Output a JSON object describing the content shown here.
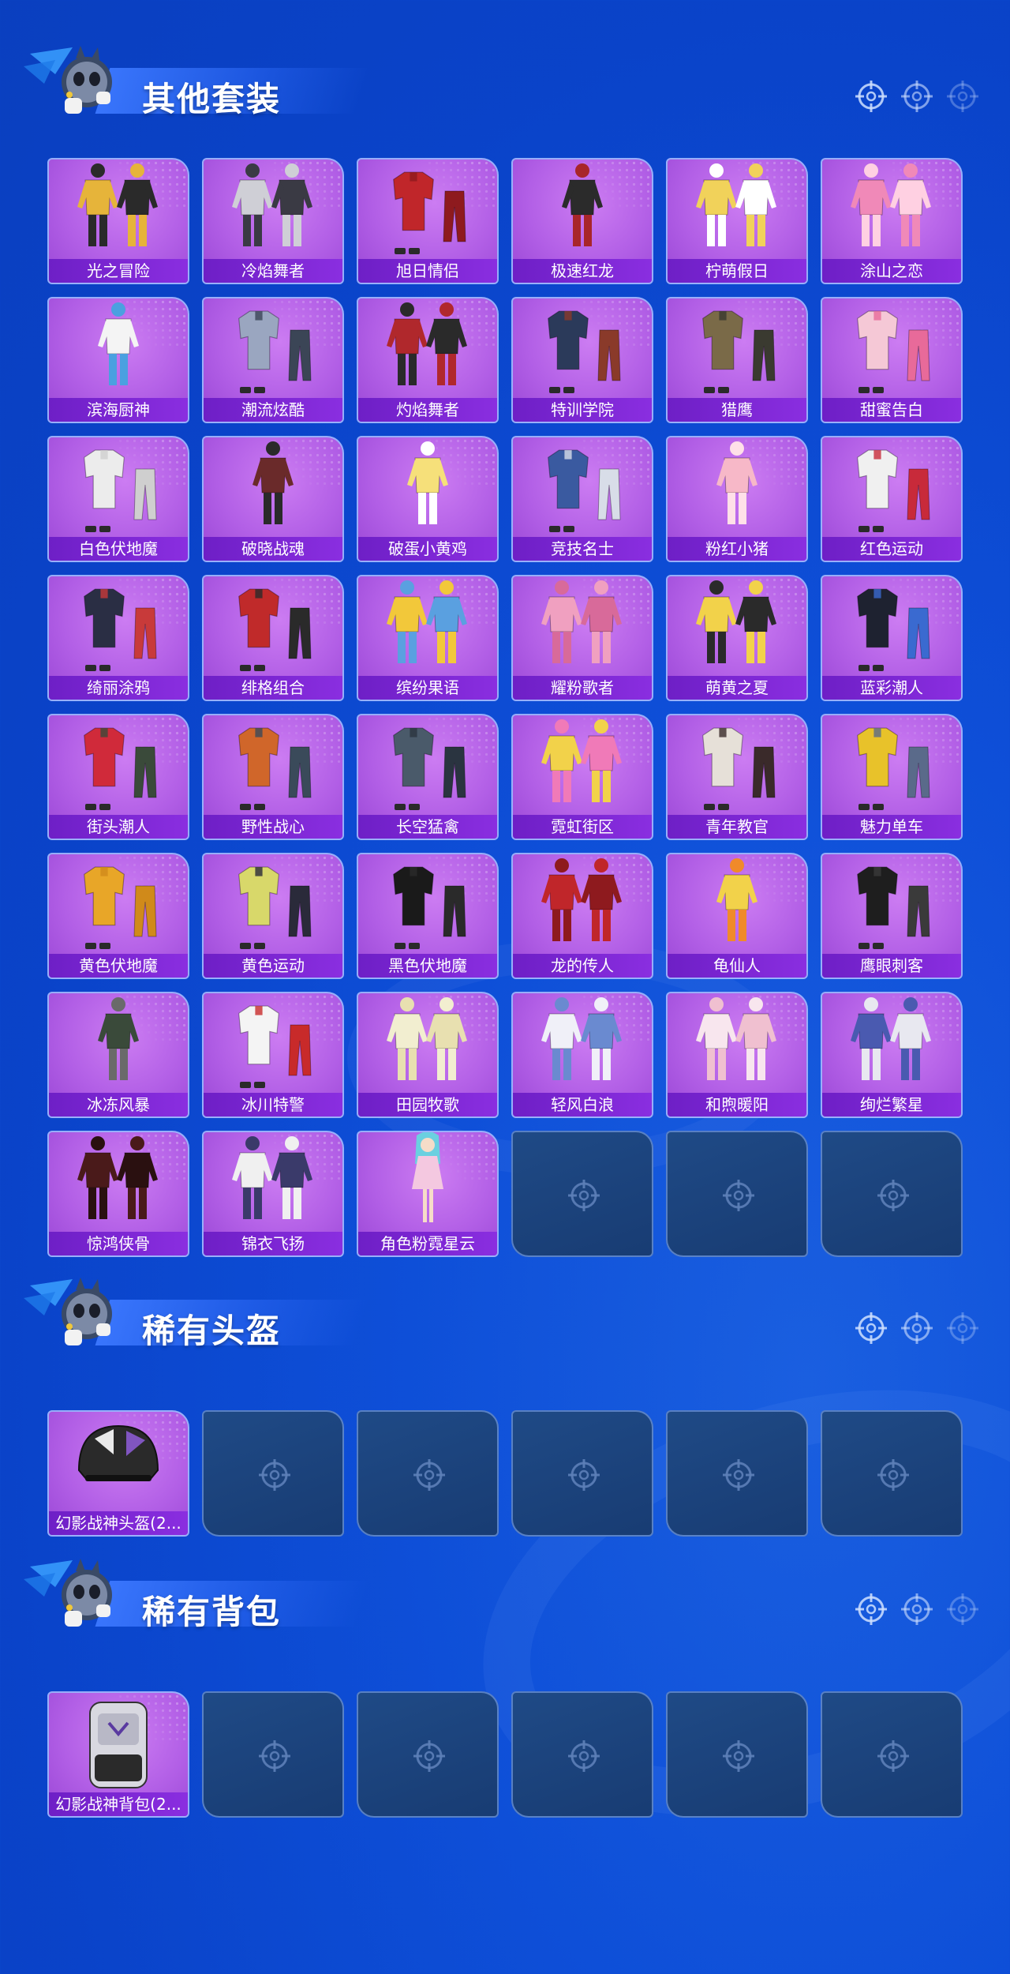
{
  "sections": [
    {
      "id": "sets",
      "title": "其他套装",
      "items": [
        {
          "label": "光之冒险",
          "kind": "duo",
          "c1": "#e6b43a",
          "c2": "#2a2a2a"
        },
        {
          "label": "冷焰舞者",
          "kind": "duo",
          "c1": "#cfcfd6",
          "c2": "#3a3a44"
        },
        {
          "label": "旭日情侣",
          "kind": "outfit",
          "c1": "#c0262a",
          "c2": "#8e1a1e"
        },
        {
          "label": "极速红龙",
          "kind": "figure",
          "c1": "#2b2b2b",
          "c2": "#a8262a"
        },
        {
          "label": "柠萌假日",
          "kind": "duo",
          "c1": "#f1d25a",
          "c2": "#ffffff"
        },
        {
          "label": "涂山之恋",
          "kind": "duo",
          "c1": "#f089b8",
          "c2": "#ffd0e2"
        },
        {
          "label": "滨海厨神",
          "kind": "figure",
          "c1": "#f4f4f4",
          "c2": "#4aa0e0"
        },
        {
          "label": "潮流炫酷",
          "kind": "outfit",
          "c1": "#9aa6c0",
          "c2": "#3b4556"
        },
        {
          "label": "灼焰舞者",
          "kind": "duo",
          "c1": "#b0282c",
          "c2": "#2a2a2a"
        },
        {
          "label": "特训学院",
          "kind": "outfit",
          "c1": "#2b3a5a",
          "c2": "#8a3a2a"
        },
        {
          "label": "猎鹰",
          "kind": "outfit",
          "c1": "#7a6a48",
          "c2": "#3a3a30"
        },
        {
          "label": "甜蜜告白",
          "kind": "outfit",
          "c1": "#f5c8d6",
          "c2": "#e86a9a"
        },
        {
          "label": "白色伏地魔",
          "kind": "outfit",
          "c1": "#ececec",
          "c2": "#cfcfcf"
        },
        {
          "label": "破晓战魂",
          "kind": "figure",
          "c1": "#6a2a2a",
          "c2": "#2a2a2a"
        },
        {
          "label": "破蛋小黄鸡",
          "kind": "figure",
          "c1": "#f6e07a",
          "c2": "#ffffff"
        },
        {
          "label": "竞技名士",
          "kind": "outfit",
          "c1": "#3a5aa0",
          "c2": "#d8dde8"
        },
        {
          "label": "粉红小猪",
          "kind": "figure",
          "c1": "#f7b8c8",
          "c2": "#ffe0e8"
        },
        {
          "label": "红色运动",
          "kind": "outfit",
          "c1": "#f0f0f0",
          "c2": "#c82a3a"
        },
        {
          "label": "绮丽涂鸦",
          "kind": "outfit",
          "c1": "#2a2e44",
          "c2": "#c83a3a"
        },
        {
          "label": "绯格组合",
          "kind": "outfit",
          "c1": "#c02a2a",
          "c2": "#2a2a2a"
        },
        {
          "label": "缤纷果语",
          "kind": "duo",
          "c1": "#f2c83a",
          "c2": "#5aa0e0"
        },
        {
          "label": "耀粉歌者",
          "kind": "duo",
          "c1": "#f0a0c0",
          "c2": "#d86a9a"
        },
        {
          "label": "萌黄之夏",
          "kind": "duo",
          "c1": "#f2d24a",
          "c2": "#2a2a2a"
        },
        {
          "label": "蓝彩潮人",
          "kind": "outfit",
          "c1": "#1e2230",
          "c2": "#3a6ad0"
        },
        {
          "label": "街头潮人",
          "kind": "outfit",
          "c1": "#d02a3a",
          "c2": "#3a4a3a"
        },
        {
          "label": "野性战心",
          "kind": "outfit",
          "c1": "#d0662a",
          "c2": "#3a4a5a"
        },
        {
          "label": "长空猛禽",
          "kind": "outfit",
          "c1": "#4a5a6a",
          "c2": "#2a3440"
        },
        {
          "label": "霓虹街区",
          "kind": "duo",
          "c1": "#f2d24a",
          "c2": "#f07ab8"
        },
        {
          "label": "青年教官",
          "kind": "outfit",
          "c1": "#e6e0d8",
          "c2": "#3a2a2a"
        },
        {
          "label": "魅力单车",
          "kind": "outfit",
          "c1": "#e8c22a",
          "c2": "#5a6a8a"
        },
        {
          "label": "黄色伏地魔",
          "kind": "outfit",
          "c1": "#e8a628",
          "c2": "#d08a1a"
        },
        {
          "label": "黄色运动",
          "kind": "outfit",
          "c1": "#d8d86a",
          "c2": "#2a2a3a"
        },
        {
          "label": "黑色伏地魔",
          "kind": "outfit",
          "c1": "#1a1a1a",
          "c2": "#2a2a2a"
        },
        {
          "label": "龙的传人",
          "kind": "duo",
          "c1": "#c0262a",
          "c2": "#8e1a1e"
        },
        {
          "label": "龟仙人",
          "kind": "figure",
          "c1": "#f2d24a",
          "c2": "#f08a2a"
        },
        {
          "label": "鹰眼刺客",
          "kind": "outfit",
          "c1": "#1e1e1e",
          "c2": "#3a3a3a"
        },
        {
          "label": "冰冻风暴",
          "kind": "figure",
          "c1": "#3a4a3a",
          "c2": "#6a6a6a"
        },
        {
          "label": "冰川特警",
          "kind": "outfit",
          "c1": "#f4f4f4",
          "c2": "#c82a2a"
        },
        {
          "label": "田园牧歌",
          "kind": "duo",
          "c1": "#f2eed0",
          "c2": "#e8e0b0"
        },
        {
          "label": "轻风白浪",
          "kind": "duo",
          "c1": "#f0f0f8",
          "c2": "#6a8ad0"
        },
        {
          "label": "和煦暖阳",
          "kind": "duo",
          "c1": "#f8e6ee",
          "c2": "#f0c0d0"
        },
        {
          "label": "绚烂繁星",
          "kind": "duo",
          "c1": "#4a5ab0",
          "c2": "#e8e8f0"
        },
        {
          "label": "惊鸿侠骨",
          "kind": "duo",
          "c1": "#4a1a1a",
          "c2": "#2a1010"
        },
        {
          "label": "锦衣飞扬",
          "kind": "duo",
          "c1": "#f0f0f0",
          "c2": "#3a3a6a"
        },
        {
          "label": "角色粉霓星云",
          "kind": "girl",
          "c1": "#f4c8e0",
          "c2": "#6ad0e0"
        }
      ],
      "total_slots": 48
    },
    {
      "id": "helmets",
      "title": "稀有头盔",
      "items": [
        {
          "label": "幻影战神头盔(2...",
          "kind": "helmet",
          "c1": "#2a2a2a",
          "c2": "#ffffff"
        }
      ],
      "total_slots": 6
    },
    {
      "id": "backpacks",
      "title": "稀有背包",
      "items": [
        {
          "label": "幻影战神背包(2...",
          "kind": "backpack",
          "c1": "#d8d8e0",
          "c2": "#2a2a2a"
        }
      ],
      "total_slots": 6
    }
  ],
  "icons": {
    "header": [
      "crosshair-icon",
      "crosshair-icon",
      "crosshair-icon"
    ],
    "empty_slot": "crosshair-icon",
    "mascot": "mascot-icon"
  },
  "colors": {
    "background": "#0a43c9",
    "card_purple": "#b25fe6",
    "label_purple": "#7a26d4",
    "empty_slot": "#1c437e",
    "card_border": "#96beff"
  }
}
